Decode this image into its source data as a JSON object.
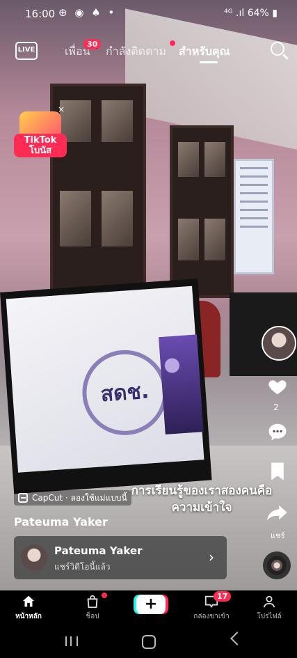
{
  "status_bar": {
    "time": "16:00",
    "notification_icons": "⊕ ◉ ♠ •",
    "signal": "⁴ᴳ .ıl",
    "battery": "64%"
  },
  "top_nav": {
    "live_label": "LIVE",
    "tabs": [
      {
        "label": "เพื่อน",
        "badge": "30"
      },
      {
        "label": "กำลังติดตาม"
      },
      {
        "label": "สำหรับคุณ",
        "active": true
      }
    ]
  },
  "bonus_widget": {
    "label": "TikTok\nโบนัส",
    "close": "×"
  },
  "video": {
    "monitor_logo_text": "สดช.",
    "caption": "การเรียนรู้ของเราสองคนคือความเข้าใจ"
  },
  "side_actions": {
    "like_count": "2",
    "share_label": "แชร์"
  },
  "capcut": {
    "text": "CapCut · ลองใช้แม่แบบนี้"
  },
  "author_name": "Pateuma Yaker",
  "repost_card": {
    "name": "Pateuma Yaker",
    "subtitle": "แชร์วิดีโอนี้แล้ว",
    "chevron": "›"
  },
  "bottom_nav": {
    "home_label": "หน้าหลัก",
    "shop_label": "ช็อป",
    "create_label": "+",
    "inbox_label": "กล่องขาเข้า",
    "inbox_badge": "17",
    "profile_label": "โปรไฟล์"
  },
  "colors": {
    "accent": "#fe2c55",
    "cyan": "#25f4ee"
  }
}
